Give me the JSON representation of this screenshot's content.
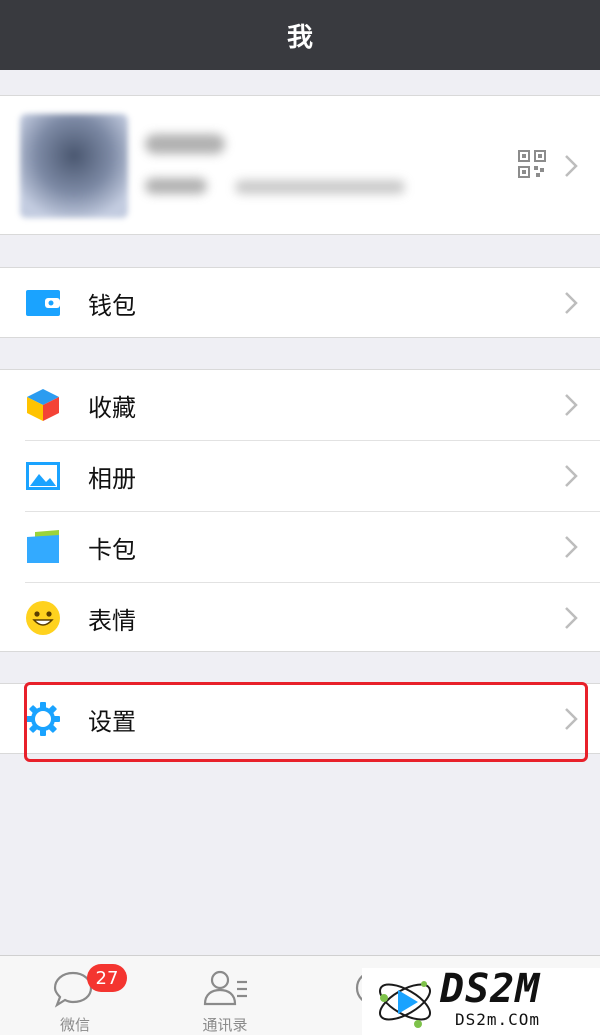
{
  "header": {
    "title": "我"
  },
  "wallet": {
    "label": "钱包"
  },
  "menu": {
    "items": [
      {
        "label": "收藏",
        "icon": "favorites-cube-icon"
      },
      {
        "label": "相册",
        "icon": "album-picture-icon"
      },
      {
        "label": "卡包",
        "icon": "card-wallet-icon"
      },
      {
        "label": "表情",
        "icon": "smiley-face-icon"
      }
    ]
  },
  "settings": {
    "label": "设置"
  },
  "tabbar": {
    "tabs": [
      {
        "label": "微信",
        "badge": "27"
      },
      {
        "label": "通讯录"
      }
    ]
  },
  "watermark": {
    "brand": "DS2M",
    "url": "DS2m.COm"
  },
  "colors": {
    "header_bg": "#393a3f",
    "highlight": "#e8202a",
    "badge": "#f43530",
    "icon_blue": "#1aa3ff"
  }
}
